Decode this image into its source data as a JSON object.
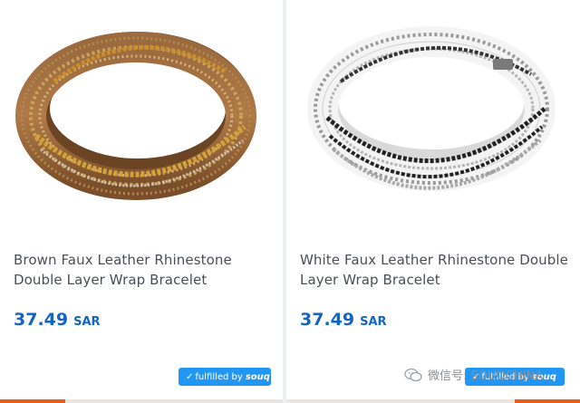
{
  "products": [
    {
      "title_line1": "Brown Faux Leather Rhinestone",
      "title_line2": "Double Layer Wrap Bracelet",
      "price": "37.49",
      "currency": "SAR",
      "badge": {
        "prefix": "✓",
        "label": "fulfilled by",
        "brand": "souq"
      }
    },
    {
      "title_line1": "White Faux Leather Rhinestone Double",
      "title_line2": "Layer Wrap Bracelet",
      "price": "37.49",
      "currency": "SAR",
      "badge": {
        "prefix": "✓",
        "label": "fulfilled by",
        "brand": "souq"
      }
    }
  ],
  "watermark": {
    "text": "微信号: SOUQCHINA",
    "icon": "wechat-icon"
  },
  "colors": {
    "price": "#1565c0",
    "badge": "#2196f3",
    "accent": "#e85a1e",
    "title": "#4a4f55"
  }
}
